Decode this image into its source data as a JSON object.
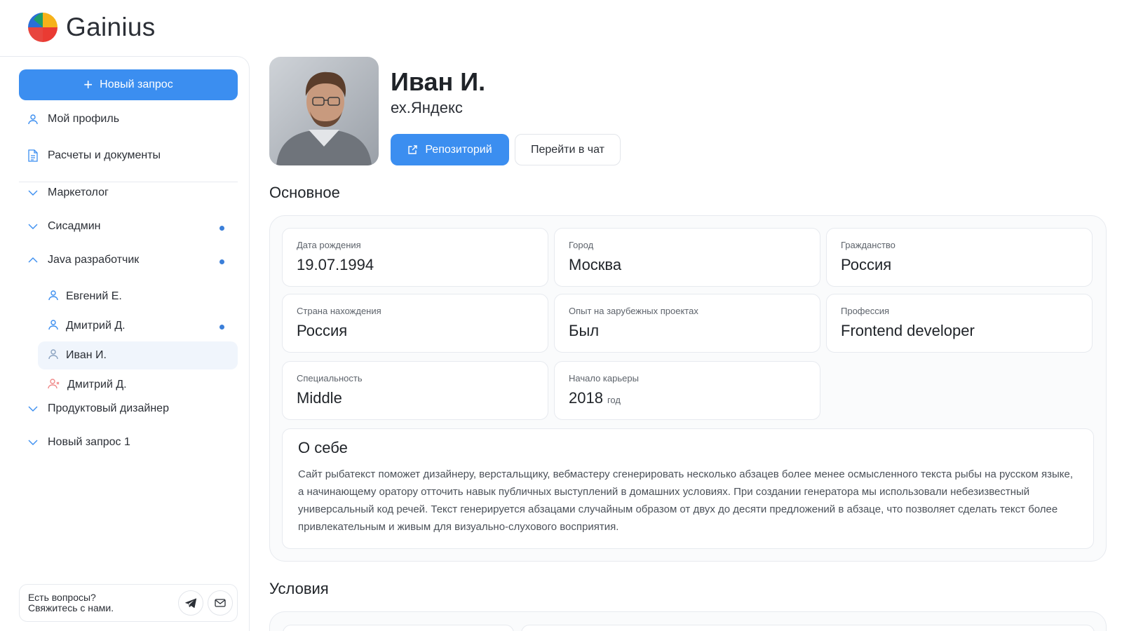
{
  "app": {
    "name": "Gainius"
  },
  "colors": {
    "accent": "#3b8ef0",
    "dot": "#3b7fd9",
    "active_bg": "#f0f5fc"
  },
  "sidebar": {
    "new_request": "Новый запрос",
    "items": [
      {
        "label": "Мой профиль",
        "icon": "user-icon"
      },
      {
        "label": "Расчеты и документы",
        "icon": "document-icon"
      }
    ],
    "groups": [
      {
        "label": "Маркетолог",
        "expanded": false,
        "dot": false
      },
      {
        "label": "Сисадмин",
        "expanded": false,
        "dot": true
      },
      {
        "label": "Java разработчик",
        "expanded": true,
        "dot": true,
        "candidates": [
          {
            "label": "Евгений Е.",
            "dot": false
          },
          {
            "label": "Дмитрий Д.",
            "dot": true
          },
          {
            "label": "Иван И.",
            "dot": false,
            "active": true
          },
          {
            "label": "Дмитрий Д.",
            "dot": false,
            "icon": "user-remove-icon"
          }
        ]
      },
      {
        "label": "Продуктовый дизайнер",
        "expanded": false,
        "dot": false
      },
      {
        "label": "Новый запрос 1",
        "expanded": false,
        "dot": false
      }
    ],
    "contact": {
      "line1": "Есть вопросы?",
      "line2": "Свяжитесь с нами."
    }
  },
  "profile": {
    "name": "Иван И.",
    "company": "ех.Яндекс",
    "repo_button": "Репозиторий",
    "chat_button": "Перейти в чат"
  },
  "main_section": {
    "title": "Основное",
    "fields": [
      {
        "label": "Дата рождения",
        "value": "19.07.1994"
      },
      {
        "label": "Город",
        "value": "Москва"
      },
      {
        "label": "Гражданство",
        "value": "Россия"
      },
      {
        "label": "Страна нахождения",
        "value": "Россия"
      },
      {
        "label": "Опыт на зарубежных проектах",
        "value": "Был"
      },
      {
        "label": "Профессия",
        "value": "Frontend developer"
      },
      {
        "label": "Специальность",
        "value": "Middle"
      },
      {
        "label": "Начало карьеры",
        "value": "2018",
        "unit": "год"
      }
    ],
    "about": {
      "title": "О себе",
      "text": "Сайт рыбатекст поможет дизайнеру, верстальщику, вебмастеру сгенерировать несколько абзацев более менее осмысленного текста рыбы на русском языке, а начинающему оратору отточить навык публичных выступлений в домашних условиях. При создании генератора мы использовали небезизвестный универсальный код речей. Текст генерируется абзацами случайным образом от двух до десяти предложений в абзаце, что позволяет сделать текст более привлекательным и живым для визуально-слухового восприятия."
    }
  },
  "conditions_section": {
    "title": "Условия"
  }
}
